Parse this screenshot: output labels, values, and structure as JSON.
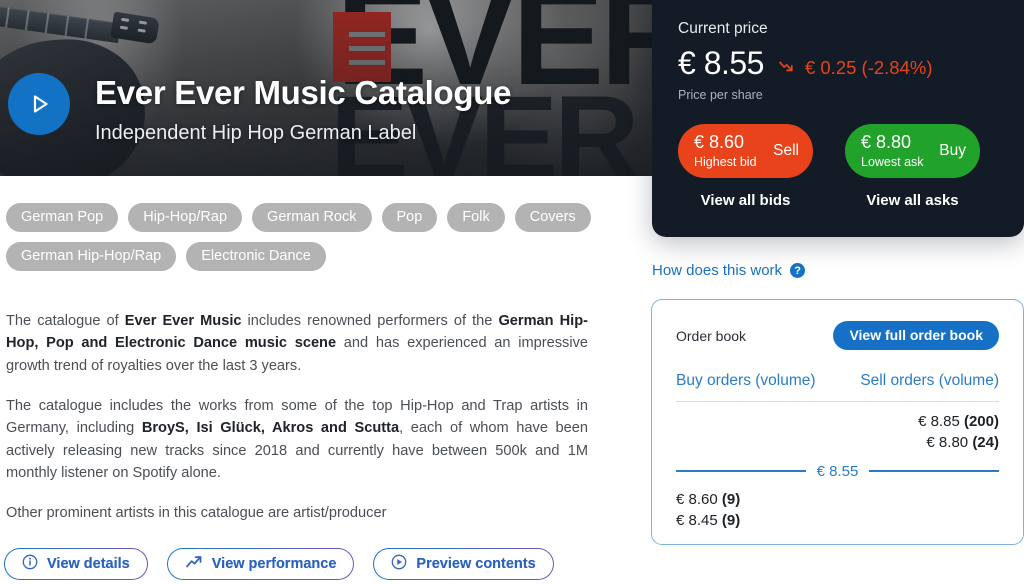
{
  "hero": {
    "title": "Ever Ever Music Catalogue",
    "subtitle": "Independent Hip Hop German Label",
    "logo_letter": "E",
    "backdrop_word": "EVER",
    "play_icon": "play-icon"
  },
  "tags": [
    "German Pop",
    "Hip-Hop/Rap",
    "German Rock",
    "Pop",
    "Folk",
    "Covers",
    "German Hip-Hop/Rap",
    "Electronic Dance"
  ],
  "description": {
    "p1_a": "The catalogue of ",
    "p1_b": "Ever Ever Music",
    "p1_c": " includes renowned performers of the ",
    "p1_d": "German Hip-Hop, Pop and Electronic Dance music scene",
    "p1_e": " and has experienced an impressive growth trend of royalties over the last 3 years.",
    "p2_a": "The catalogue includes the works from some of the top Hip-Hop and Trap artists in Germany, including ",
    "p2_b": "BroyS, Isi Glück, Akros and Scutta",
    "p2_c": ", each of whom have been actively releasing new tracks since 2018 and currently have between 500k and 1M monthly listener on Spotify alone.",
    "p3": "Other prominent artists in this catalogue are artist/producer"
  },
  "actions": [
    {
      "label": "View details",
      "icon": "info-circle-icon"
    },
    {
      "label": "View performance",
      "icon": "trend-up-arrow-icon"
    },
    {
      "label": "Preview contents",
      "icon": "play-circle-icon"
    }
  ],
  "price_card": {
    "label": "Current price",
    "price": "€ 8.55",
    "delta": "€ 0.25 (-2.84%)",
    "delta_icon": "trend-down-arrow-icon",
    "delta_color": "#e8431b",
    "sub": "Price per share",
    "sell": {
      "amount": "€ 8.60",
      "caption": "Highest bid",
      "action": "Sell",
      "color": "#e8431b",
      "link": "View all bids"
    },
    "buy": {
      "amount": "€ 8.80",
      "caption": "Lowest ask",
      "action": "Buy",
      "color": "#21a32b",
      "link": "View all asks"
    }
  },
  "how_it_works": {
    "label": "How does this work",
    "icon": "question-mark-circle-icon"
  },
  "order_book": {
    "title": "Order book",
    "view_full_label": "View full order book",
    "buy_column": "Buy orders (volume)",
    "sell_column": "Sell orders (volume)",
    "mid_price": "€ 8.55",
    "sell_orders": [
      {
        "price": "€ 8.85",
        "volume": "(200)"
      },
      {
        "price": "€ 8.80",
        "volume": "(24)"
      }
    ],
    "buy_orders": [
      {
        "price": "€ 8.60",
        "volume": "(9)"
      },
      {
        "price": "€ 8.45",
        "volume": "(9)"
      }
    ]
  }
}
